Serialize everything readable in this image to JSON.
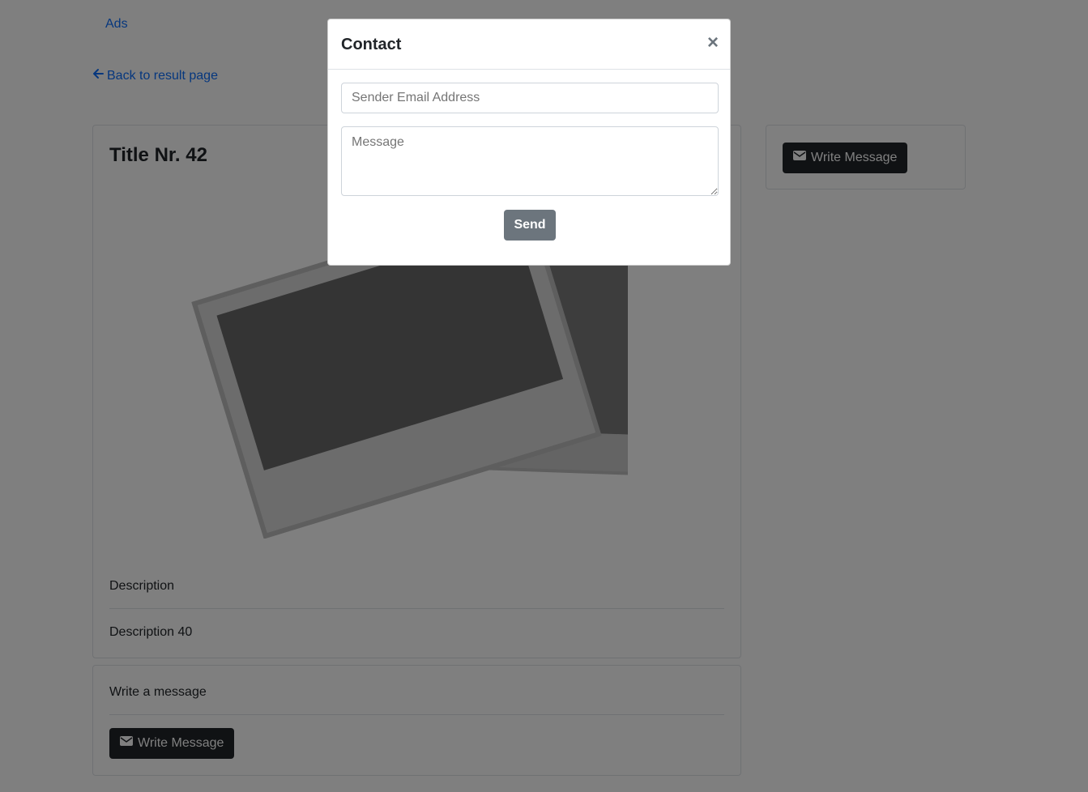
{
  "nav": {
    "ads_label": "Ads",
    "back_label": "Back to result page"
  },
  "listing": {
    "title": "Title Nr. 42",
    "description_label": "Description",
    "description_value": "Description 40",
    "write_message_heading": "Write a message",
    "write_message_button": "Write Message"
  },
  "sidebar": {
    "write_message_button": "Write Message"
  },
  "modal": {
    "title": "Contact",
    "close_symbol": "×",
    "email_placeholder": "Sender Email Address",
    "message_placeholder": "Message",
    "send_label": "Send"
  },
  "icons": {
    "back": "arrow-left-icon",
    "envelope": "envelope-icon",
    "image": "image-placeholder-icon"
  },
  "colors": {
    "link": "#0d6efd",
    "dark_button": "#212529",
    "send_button": "#6c757d",
    "backdrop": "rgba(0,0,0,0.5)"
  }
}
